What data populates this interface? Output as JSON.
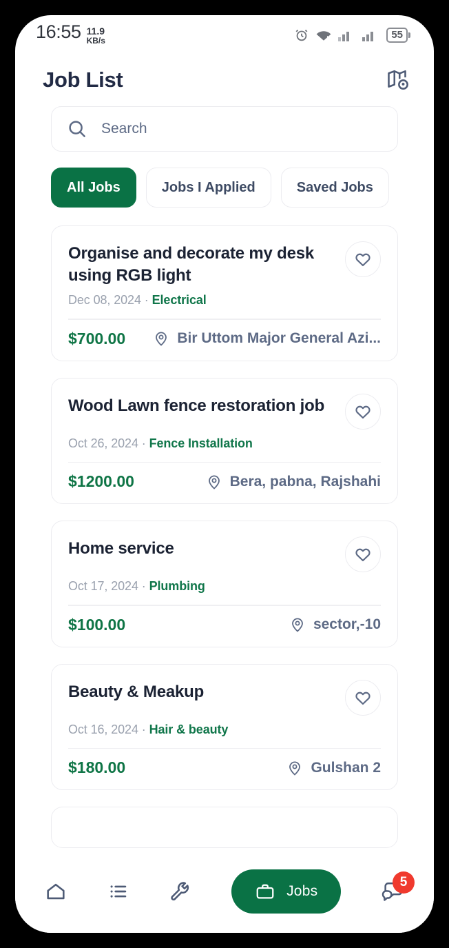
{
  "statusbar": {
    "time": "16:55",
    "net_speed_value": "11.9",
    "net_speed_unit": "KB/s",
    "alarm_icon": "alarm-clock-icon",
    "wifi_icon": "wifi-icon",
    "signal_icon": "cellular-signal-icon",
    "battery_level": "55"
  },
  "header": {
    "title": "Job List",
    "map_icon": "map-pin-icon"
  },
  "search": {
    "placeholder": "Search",
    "icon": "search-icon"
  },
  "filters": [
    {
      "label": "All Jobs",
      "active": true
    },
    {
      "label": "Jobs I Applied",
      "active": false
    },
    {
      "label": "Saved Jobs",
      "active": false
    }
  ],
  "jobs": [
    {
      "title": "Organise and decorate my desk using RGB light",
      "date": "Dec 08, 2024",
      "separator": "·",
      "category": "Electrical",
      "price": "$700.00",
      "location": "Bir Uttom Major General Azi...",
      "favorite_icon": "heart-icon",
      "location_icon": "location-pin-icon"
    },
    {
      "title": "Wood Lawn fence restoration job",
      "date": "Oct 26, 2024",
      "separator": "·",
      "category": "Fence Installation",
      "price": "$1200.00",
      "location": "Bera, pabna, Rajshahi",
      "favorite_icon": "heart-icon",
      "location_icon": "location-pin-icon"
    },
    {
      "title": "Home service",
      "date": "Oct 17, 2024",
      "separator": "·",
      "category": "Plumbing",
      "price": "$100.00",
      "location": "sector,-10",
      "favorite_icon": "heart-icon",
      "location_icon": "location-pin-icon"
    },
    {
      "title": "Beauty & Meakup",
      "date": "Oct 16, 2024",
      "separator": "·",
      "category": "Hair & beauty",
      "price": "$180.00",
      "location": "Gulshan 2",
      "favorite_icon": "heart-icon",
      "location_icon": "location-pin-icon"
    }
  ],
  "bottom_nav": {
    "items": [
      {
        "name": "home",
        "icon": "home-icon"
      },
      {
        "name": "list",
        "icon": "list-icon"
      },
      {
        "name": "services",
        "icon": "wrench-icon"
      }
    ],
    "active_pill": {
      "label": "Jobs",
      "icon": "briefcase-icon"
    },
    "messages": {
      "icon": "chat-bubbles-icon",
      "badge": "5"
    }
  },
  "colors": {
    "brand_green": "#0a7245",
    "price_green": "#0f7546",
    "category_green": "#10764a",
    "title_navy": "#1b2233",
    "muted_gray": "#9aa1ae",
    "slate": "#5d6a85",
    "badge_red": "#f03a2e",
    "border": "#ececf0"
  }
}
